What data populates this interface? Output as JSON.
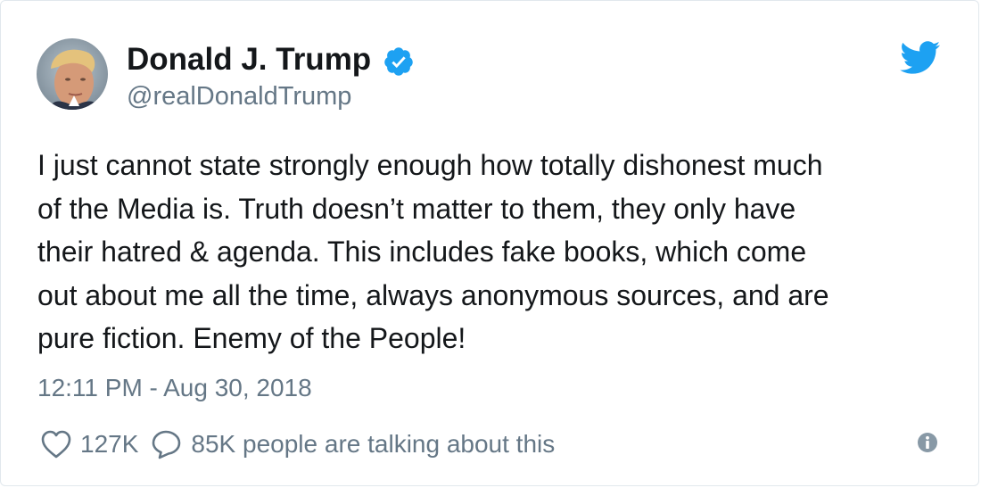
{
  "tweet": {
    "display_name": "Donald J. Trump",
    "handle": "@realDonaldTrump",
    "text": "I just cannot state strongly enough how totally dishonest much\nof the Media is. Truth doesn’t matter to them, they only have\ntheir hatred & agenda. This includes fake books, which come\nout about me all the time, always anonymous sources, and are\npure fiction. Enemy of the People!",
    "timestamp": "12:11 PM - Aug 30, 2018",
    "likes": "127K",
    "talking": "85K people are talking about this"
  },
  "icons": {
    "verified": "verified-badge-icon",
    "brand": "twitter-bird-icon",
    "like": "heart-icon",
    "reply": "speech-bubble-icon",
    "info": "info-icon"
  },
  "colors": {
    "brand_blue": "#1da1f2",
    "text": "#14171a",
    "secondary": "#657786",
    "border": "#e1e8ed"
  }
}
